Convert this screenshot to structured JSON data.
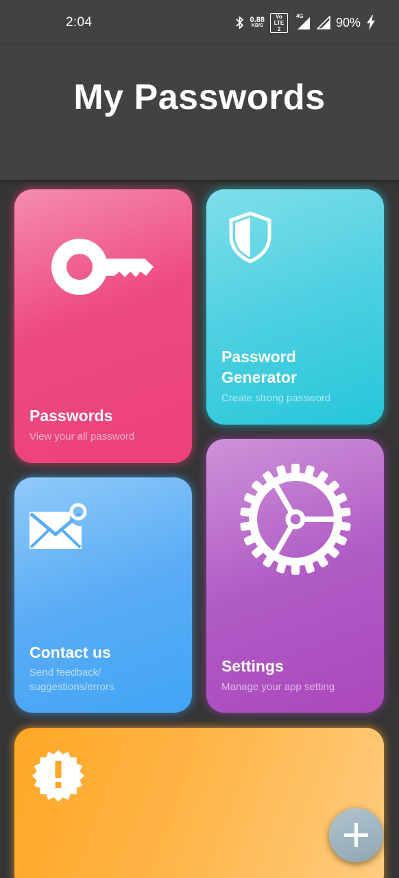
{
  "status_bar": {
    "time": "2:04",
    "net_speed_value": "0.88",
    "net_speed_unit": "KB/S",
    "volte_label": "Vo LTE 2",
    "network_type": "4G",
    "battery_percent": "90%",
    "icons": [
      "bluetooth-icon",
      "signal-icon",
      "signal-icon",
      "charging-icon"
    ]
  },
  "header": {
    "title": "My Passwords",
    "background": "#424242"
  },
  "cards": {
    "passwords": {
      "title": "Passwords",
      "subtitle": "View your all password",
      "icon": "key-icon",
      "color": "#ec407a"
    },
    "generator": {
      "title_line1": "Password",
      "title_line2": "Generator",
      "subtitle": "Create strong password",
      "icon": "shield-icon",
      "color": "#26c6da"
    },
    "contact": {
      "title": "Contact us",
      "subtitle_line1": "Send feedback/",
      "subtitle_line2": "suggestions/errors",
      "icon": "mail-notification-icon",
      "color": "#42a5f5"
    },
    "settings": {
      "title": "Settings",
      "subtitle": "Manage your app setting",
      "icon": "gear-icon",
      "color": "#ab47bc"
    },
    "alert": {
      "icon": "alert-badge-icon",
      "color": "#ffa726"
    }
  },
  "fab": {
    "icon": "plus-icon"
  }
}
